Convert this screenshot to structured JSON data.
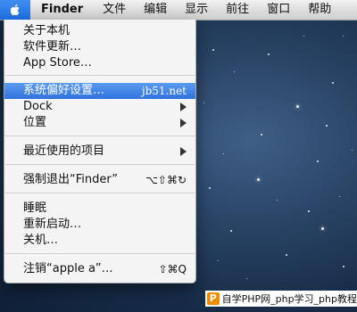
{
  "menubar": {
    "apple_menu": "apple-icon",
    "app_name": "Finder",
    "menus": [
      "文件",
      "编辑",
      "显示",
      "前往",
      "窗口",
      "帮助"
    ]
  },
  "apple_menu": {
    "items": {
      "about": "关于本机",
      "software_update": "软件更新…",
      "app_store": "App Store…",
      "system_prefs": "系统偏好设置…",
      "system_prefs_shortcut": "jb51.net",
      "dock": "Dock",
      "location": "位置",
      "recent_items": "最近使用的项目",
      "force_quit": "强制退出“Finder”",
      "force_quit_shortcut": "⌥⇧⌘↻",
      "sleep": "睡眠",
      "restart": "重新启动…",
      "shutdown": "关机…",
      "logout": "注销“apple a”…",
      "logout_shortcut": "⇧⌘Q"
    }
  },
  "watermark": {
    "badge": "P",
    "text": "自学PHP网_php学习_php教程"
  },
  "colors": {
    "highlight": "#2f72de",
    "menubar_bg": "#dcdcdc",
    "menu_bg": "#f4f4f4",
    "watermark_badge": "#f08a00"
  }
}
